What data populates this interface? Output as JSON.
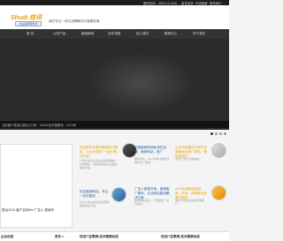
{
  "topbar": {
    "phone": "服务热线：4006-13-1346",
    "links": [
      "留言反馈",
      "在线客服",
      "联系我们"
    ]
  },
  "header": {
    "logo_text": "Shudi 炫讯",
    "logo_sub": "企业品牌服务商",
    "tagline": "我们专注一体式品牌解决方案服务商"
  },
  "nav": {
    "items": [
      "首 页",
      "公司产品",
      "营销案例",
      "合作流程",
      "加入我们",
      "新闻中心",
      "关于我们"
    ]
  },
  "banner": {
    "caption": "当前客户数量已超过4万家，24/365全天候服务，2014年"
  },
  "news_panel": {
    "line": "售后2012 客户告诉Bei 广告人 更新年"
  },
  "cards": [
    {
      "title": "炫迅提供互联网营销设计服务，为企业提供“一站式”解决方案",
      "desc": "广告文案专业企业品牌营销推广方案服务，完整地提供企业品牌解决方案。"
    },
    {
      "title": "炫迅营销网站，专注一站式服务",
      "desc": "为中小企业提供专业营销网站建设方案。"
    },
    {
      "title": "中国营销型网站领先品牌，营销网站，推广",
      "desc": "服务专业，2014年度中国最佳服务商；荣获。"
    },
    {
      "title": "广告人营销方案，营销推广服务，企业网站建设解决方案",
      "desc": "提供网站建设、广告投放一站式服务。"
    },
    {
      "title": "企业网站建设方案专业营销网站推广服务，营销型网站",
      "desc": "专业广告人方案提供。"
    },
    {
      "title": "2014年度最佳服务商，炫迅，获得最佳品牌方案奖",
      "desc": "服务专业企业品牌营销推广。"
    }
  ],
  "bottom": {
    "left_title": "企业动态",
    "mid_title": "炫迅IT互联网-技术营销动态",
    "right_title": "炫迅IT互联网-技术营销动态",
    "more": "更多 >"
  }
}
